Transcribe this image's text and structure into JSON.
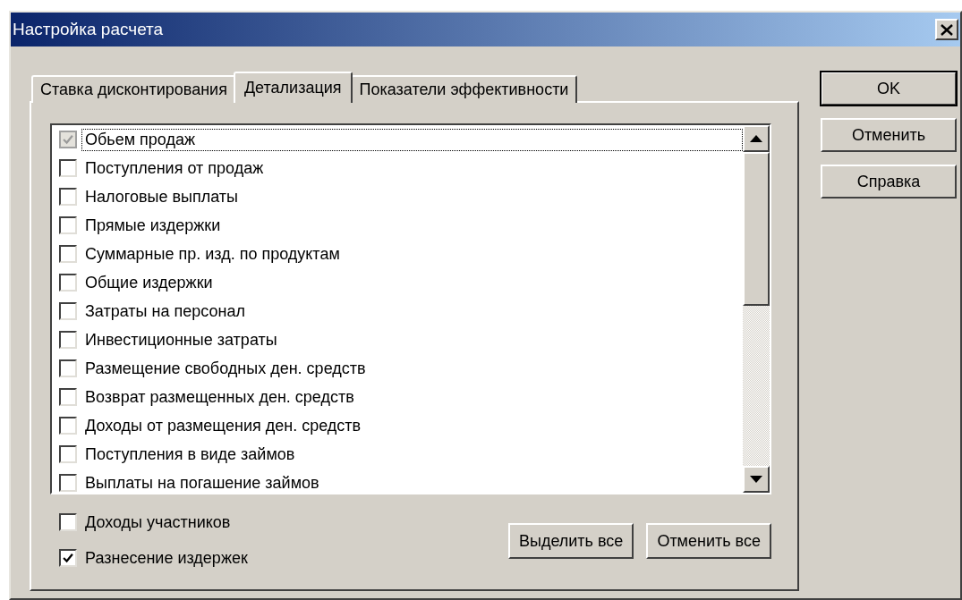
{
  "window": {
    "title": "Настройка расчета"
  },
  "tabs": [
    {
      "label": "Ставка дисконтирования",
      "selected": false
    },
    {
      "label": "Детализация",
      "selected": true
    },
    {
      "label": "Показатели эффективности",
      "selected": false
    }
  ],
  "items": [
    {
      "label": "Обьем продаж",
      "checked": true,
      "disabled": true,
      "focused": true
    },
    {
      "label": "Поступления от продаж",
      "checked": false,
      "disabled": false,
      "focused": false
    },
    {
      "label": "Налоговые выплаты",
      "checked": false,
      "disabled": false,
      "focused": false
    },
    {
      "label": "Прямые издержки",
      "checked": false,
      "disabled": false,
      "focused": false
    },
    {
      "label": "Суммарные пр. изд. по продуктам",
      "checked": false,
      "disabled": false,
      "focused": false
    },
    {
      "label": "Общие издержки",
      "checked": false,
      "disabled": false,
      "focused": false
    },
    {
      "label": "Затраты на персонал",
      "checked": false,
      "disabled": false,
      "focused": false
    },
    {
      "label": "Инвестиционные затраты",
      "checked": false,
      "disabled": false,
      "focused": false
    },
    {
      "label": "Размещение свободных ден. средств",
      "checked": false,
      "disabled": false,
      "focused": false
    },
    {
      "label": "Возврат размещенных ден. средств",
      "checked": false,
      "disabled": false,
      "focused": false
    },
    {
      "label": "Доходы от размещения ден. средств",
      "checked": false,
      "disabled": false,
      "focused": false
    },
    {
      "label": "Поступления в виде займов",
      "checked": false,
      "disabled": false,
      "focused": false
    },
    {
      "label": "Выплаты на погашение займов",
      "checked": false,
      "disabled": false,
      "focused": false
    }
  ],
  "options": [
    {
      "label": "Доходы участников",
      "checked": false
    },
    {
      "label": "Разнесение издержек",
      "checked": true
    }
  ],
  "list_buttons": [
    {
      "label": "Выделить все"
    },
    {
      "label": "Отменить все"
    }
  ],
  "dialog_buttons": [
    {
      "label": "OK",
      "default": true
    },
    {
      "label": "Отменить",
      "default": false
    },
    {
      "label": "Справка",
      "default": false
    }
  ]
}
